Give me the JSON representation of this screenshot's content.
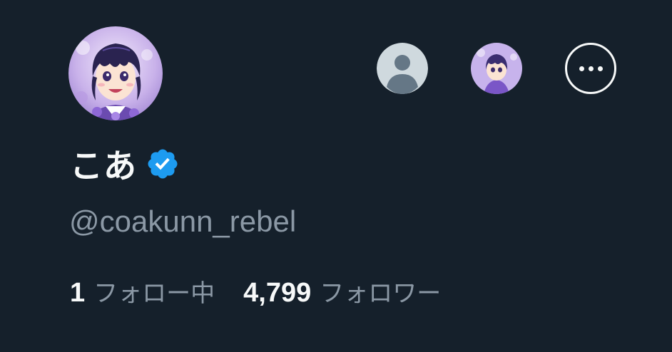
{
  "profile": {
    "display_name": "こあ",
    "handle": "@coakunn_rebel",
    "verified": true,
    "avatar": "anime-character-purple-avatar"
  },
  "header_actions": {
    "default_avatar_icon": "default-profile-icon",
    "alt_avatar": "chibi-character-avatar",
    "more_icon": "more-options-icon"
  },
  "stats": {
    "following_count": "1",
    "following_label": "フォロー中",
    "followers_count": "4,799",
    "followers_label": "フォロワー"
  },
  "colors": {
    "background": "#15202b",
    "primary_text": "#f7f9f9",
    "secondary_text": "#8b98a5",
    "verified_badge": "#1d9bf0"
  }
}
